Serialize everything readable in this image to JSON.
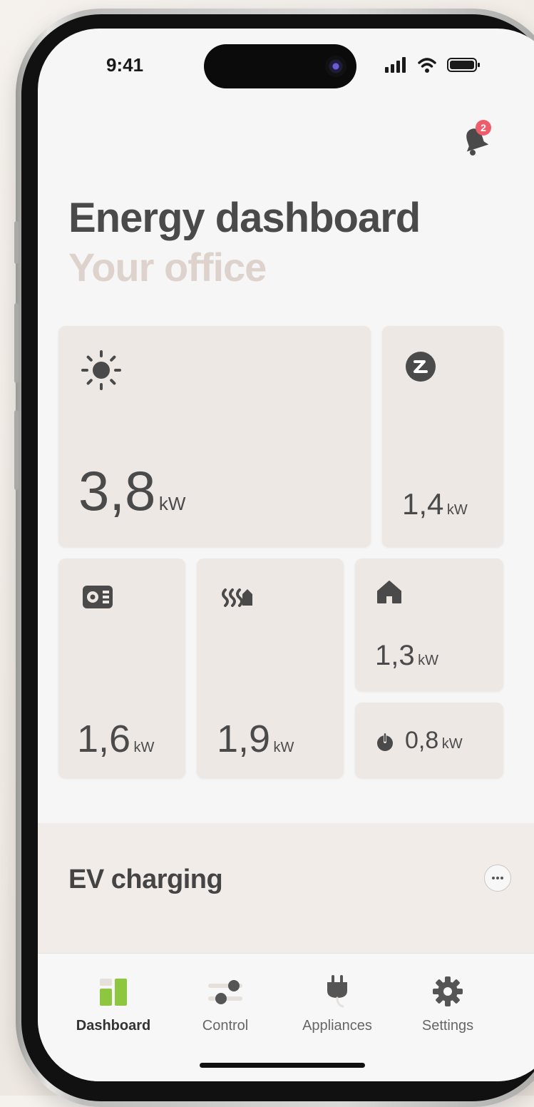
{
  "status_bar": {
    "time": "9:41"
  },
  "notifications": {
    "count": "2"
  },
  "header": {
    "title": "Energy dashboard",
    "subtitle": "Your office"
  },
  "tiles": {
    "solar": {
      "icon": "sun-icon",
      "value": "3,8",
      "unit": "kW"
    },
    "grid": {
      "icon": "grid-exchange-icon",
      "value": "1,4",
      "unit": "kW"
    },
    "battery": {
      "icon": "battery-icon",
      "value": "1,6",
      "unit": "kW"
    },
    "heat": {
      "icon": "heat-pump-icon",
      "value": "1,9",
      "unit": "kW"
    },
    "house": {
      "icon": "house-icon",
      "value": "1,3",
      "unit": "kW"
    },
    "standby": {
      "icon": "power-icon",
      "value": "0,8",
      "unit": "kW"
    }
  },
  "ev_section": {
    "title": "EV charging"
  },
  "tabs": [
    {
      "label": "Dashboard",
      "icon": "dashboard-icon",
      "active": true
    },
    {
      "label": "Control",
      "icon": "sliders-icon",
      "active": false
    },
    {
      "label": "Appliances",
      "icon": "plug-icon",
      "active": false
    },
    {
      "label": "Settings",
      "icon": "gear-icon",
      "active": false
    }
  ],
  "colors": {
    "accent": "#8dc63f",
    "tile_bg": "#ede8e4",
    "badge": "#ee5d6c"
  }
}
